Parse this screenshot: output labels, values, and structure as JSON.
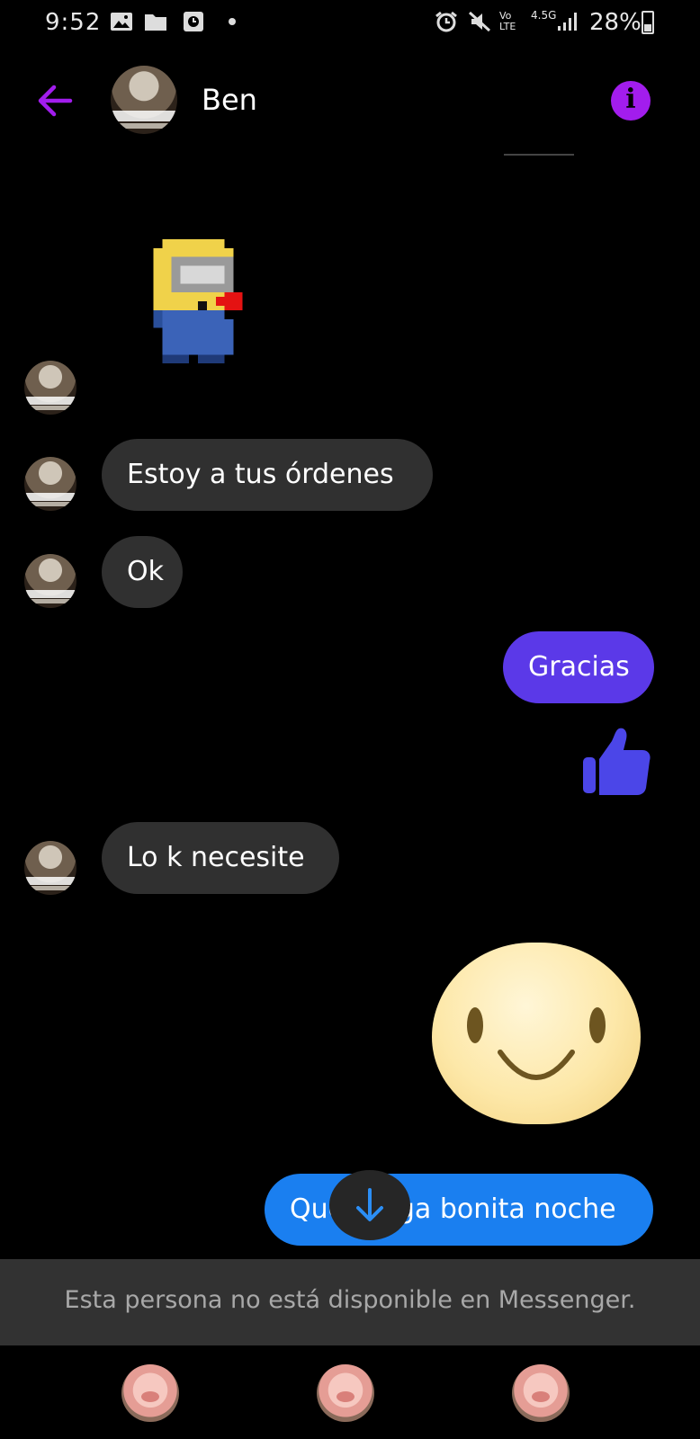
{
  "status_bar": {
    "time": "9:52",
    "network": "4.5G",
    "volte": "Vo LTE",
    "battery": "28%"
  },
  "header": {
    "contact_name": "Ben",
    "back_icon": "arrow-left-icon",
    "info_icon": "info-icon",
    "info_glyph": "i",
    "accent": "#a21ded"
  },
  "messages": [
    {
      "type": "sticker",
      "from": "them",
      "sticker": "pixel-minion"
    },
    {
      "type": "text",
      "from": "them",
      "text": "Estoy a tus órdenes"
    },
    {
      "type": "text",
      "from": "them",
      "text": "Ok"
    },
    {
      "type": "text",
      "from": "me",
      "text": "Gracias"
    },
    {
      "type": "like",
      "from": "me",
      "sticker": "thumbs-up-icon"
    },
    {
      "type": "text",
      "from": "them",
      "text": "Lo k necesite"
    },
    {
      "type": "sticker",
      "from": "me",
      "sticker": "smiley-face"
    },
    {
      "type": "text",
      "from": "me",
      "text": "Que tenga bonita noche"
    }
  ],
  "colors": {
    "sent_purple": "#5b39e8",
    "sent_blue": "#1a7ff0",
    "received": "#303030",
    "thumb": "#4b46e8"
  },
  "banner": {
    "text": "Esta persona no está disponible en Messenger."
  },
  "scroll_down_icon": "arrow-down-icon",
  "bottom_bar": {
    "items": [
      "pig-avatar",
      "pig-avatar",
      "pig-avatar"
    ]
  }
}
